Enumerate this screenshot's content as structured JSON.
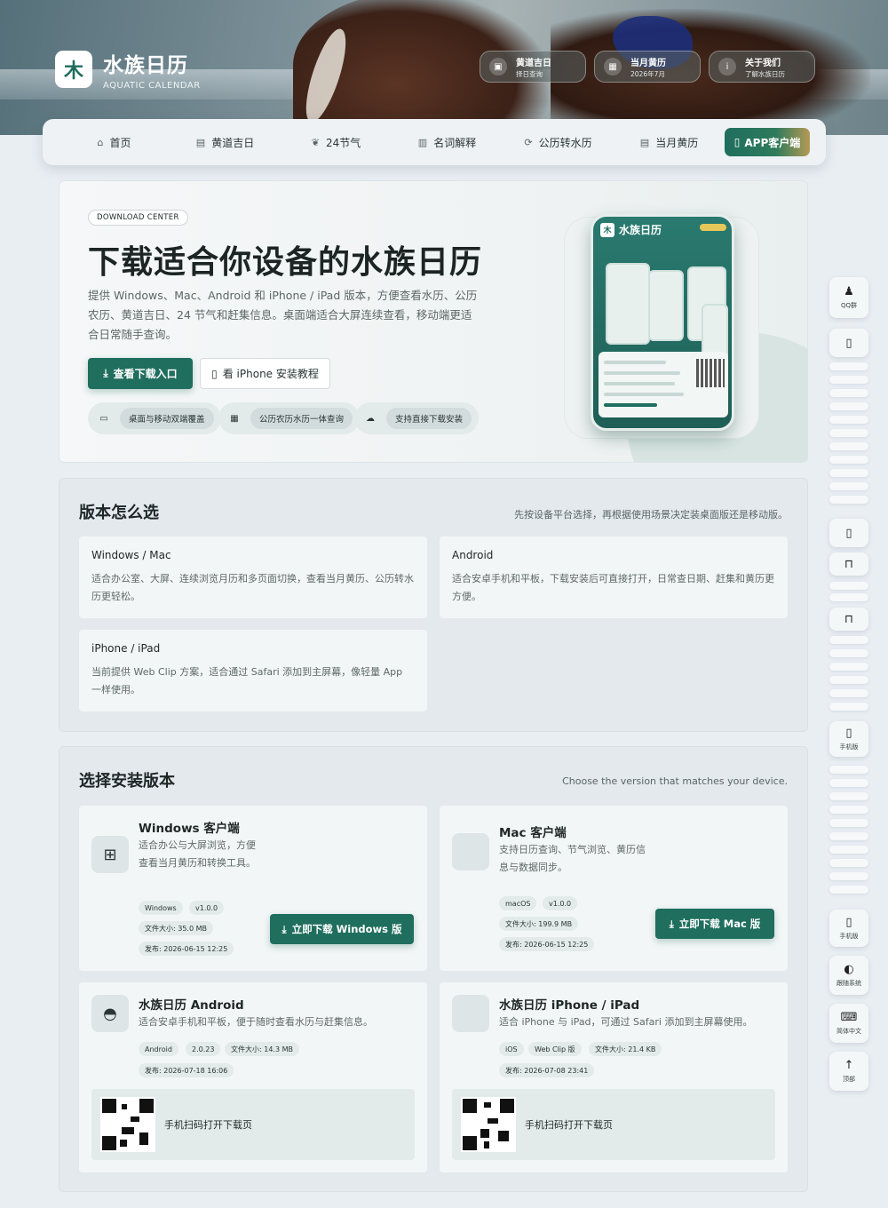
{
  "brand": {
    "name": "水族日历",
    "sub": "AQUATIC CALENDAR",
    "logo_glyph": "木"
  },
  "top_links": [
    {
      "title": "黄道吉日",
      "sub": "择日查询",
      "icon": "calendar-check-icon"
    },
    {
      "title": "当月黄历",
      "sub": "2026年7月",
      "icon": "grid-calendar-icon"
    },
    {
      "title": "关于我们",
      "sub": "了解水族日历",
      "icon": "info-icon"
    }
  ],
  "nav": {
    "items": [
      {
        "label": "首页",
        "icon": "home-icon"
      },
      {
        "label": "黄道吉日",
        "icon": "calendar-icon"
      },
      {
        "label": "24节气",
        "icon": "leaf-icon"
      },
      {
        "label": "名词解释",
        "icon": "book-icon"
      },
      {
        "label": "公历转水历",
        "icon": "refresh-icon"
      },
      {
        "label": "当月黄历",
        "icon": "calendar-icon"
      }
    ],
    "app_label": "APP客户端"
  },
  "hero": {
    "chip": "DOWNLOAD CENTER",
    "title": "下载适合你设备的水族日历",
    "desc": "提供 Windows、Mac、Android 和 iPhone / iPad 版本，方便查看水历、公历农历、黄道吉日、24 节气和赶集信息。桌面端适合大屏连续查看，移动端更适合日常随手查询。",
    "primary_btn": "查看下载入口",
    "outline_btn": "看 iPhone 安装教程",
    "features": [
      {
        "label": "桌面与移动双端覆盖",
        "icon": "monitor-icon"
      },
      {
        "label": "公历农历水历一体查询",
        "icon": "calendar-icon"
      },
      {
        "label": "支持直接下载安装",
        "icon": "cloud-download-icon"
      }
    ],
    "phone": {
      "title": "水族日历"
    }
  },
  "choose": {
    "title": "版本怎么选",
    "sub": "先按设备平台选择，再根据使用场景决定装桌面版还是移动版。",
    "items": [
      {
        "title": "Windows / Mac",
        "desc": "适合办公室、大屏、连续浏览月历和多页面切换，查看当月黄历、公历转水历更轻松。"
      },
      {
        "title": "Android",
        "desc": "适合安卓手机和平板，下载安装后可直接打开，日常查日期、赶集和黄历更方便。"
      },
      {
        "title": "iPhone / iPad",
        "desc": "当前提供 Web Clip 方案，适合通过 Safari 添加到主屏幕，像轻量 App 一样使用。"
      }
    ]
  },
  "install": {
    "title": "选择安装版本",
    "sub": "Choose the version that matches your device.",
    "windows": {
      "title": "Windows 客户端",
      "desc": "适合办公与大屏浏览，方便查看当月黄历和转换工具。",
      "tags": [
        "Windows",
        "v1.0.0"
      ],
      "size": "文件大小:  35.0 MB",
      "date": "发布:   2026-06-15 12:25",
      "btn": "立即下载 Windows 版"
    },
    "mac": {
      "title": "Mac 客户端",
      "desc": "支持日历查询、节气浏览、黄历信息与数据同步。",
      "tags": [
        "macOS",
        "v1.0.0"
      ],
      "size": "文件大小:  199.9 MB",
      "date": "发布:   2026-06-15 12:25",
      "btn": "立即下载 Mac 版"
    },
    "android": {
      "title": "水族日历 Android",
      "desc": "适合安卓手机和平板，便于随时查看水历与赶集信息。",
      "tags": [
        "Android",
        "2.0.23",
        "文件大小:  14.3 MB"
      ],
      "date": "发布:   2026-07-18 16:06",
      "qr_label": "手机扫码打开下载页"
    },
    "ios": {
      "title": "水族日历 iPhone / iPad",
      "desc": "适合 iPhone 与 iPad，可通过 Safari 添加到主屏幕使用。",
      "tags": [
        "iOS",
        "Web Clip 版",
        "文件大小:  21.4 KB"
      ],
      "date": "发布:   2026-07-08 23:41",
      "qr_label": "手机扫码打开下载页"
    }
  },
  "right_rail": {
    "qq": "QQ群",
    "mobile1": "手机版",
    "mobile2": "手机版",
    "theme": "跟随系统",
    "lang": "简体中文",
    "top": "顶部"
  },
  "colors": {
    "accent": "#1f6e5e",
    "bg": "#e9eef3",
    "card": "#f3f6f7"
  }
}
